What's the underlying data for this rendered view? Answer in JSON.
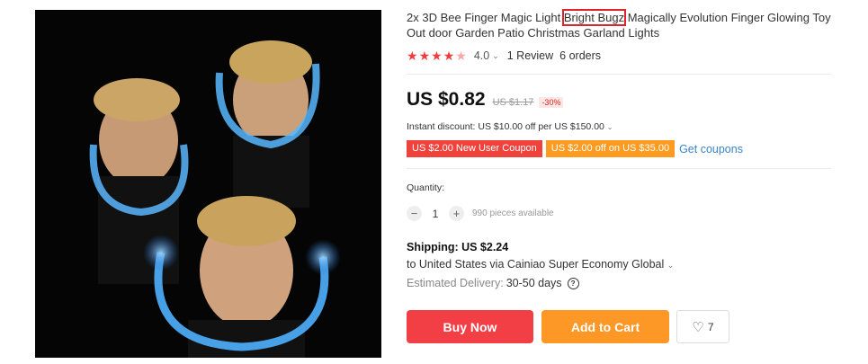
{
  "product": {
    "title_before": "2x 3D Bee Finger Magic Light ",
    "title_highlight": "Bright Bugz",
    "title_after": " Magically Evolution Finger Glowing Toy Out door Garden Patio Christmas Garland Lights",
    "rating_value": "4.0",
    "rating_stars": 4.5,
    "reviews": "1 Review",
    "orders": "6 orders",
    "image_alt": "Young man holding glowing blue light strings around his head"
  },
  "price": {
    "current": "US $0.82",
    "original": "US $1.17",
    "discount": "-30%"
  },
  "promotions": {
    "instant_discount": "Instant discount: US $10.00 off per US $150.00",
    "coupon_new_user": "US $2.00 New User Coupon",
    "coupon_threshold": "US $2.00 off on US $35.00",
    "get_coupons": "Get coupons"
  },
  "quantity": {
    "label": "Quantity:",
    "value": "1",
    "available": "990 pieces available"
  },
  "shipping": {
    "label": "Shipping: US $2.24",
    "destination": "to United States via Cainiao Super Economy Global",
    "delivery_label": "Estimated Delivery:",
    "delivery_value": "30-50 days"
  },
  "actions": {
    "buy_now": "Buy Now",
    "add_to_cart": "Add to Cart",
    "wishlist_count": "7"
  },
  "colors": {
    "accent_red": "#f23f46",
    "accent_orange": "#fd9826",
    "star_color": "#f23c3c",
    "link_blue": "#3a83c7"
  }
}
